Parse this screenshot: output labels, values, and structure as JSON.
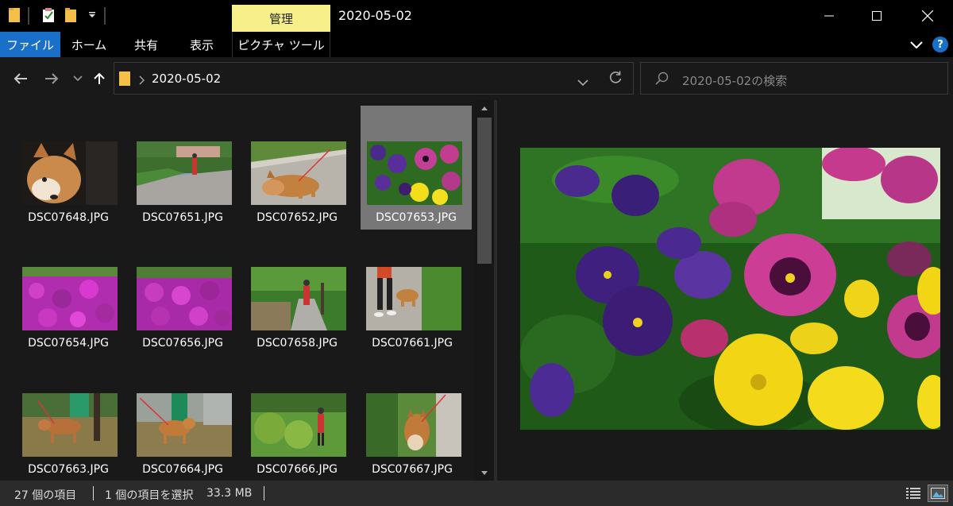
{
  "window": {
    "title": "2020-05-02",
    "manage_tab": "管理",
    "minimize_icon": "minimize-icon",
    "maximize_icon": "maximize-icon",
    "close_icon": "close-icon"
  },
  "quick_access": {
    "icons": [
      "folder-icon",
      "properties-icon",
      "new-folder-icon",
      "customize-dropdown-icon"
    ]
  },
  "ribbon": {
    "tabs": [
      "ファイル",
      "ホーム",
      "共有",
      "表示"
    ],
    "picture_tools": "ピクチャ ツール",
    "help_label": "?"
  },
  "nav": {
    "path": "2020-05-02",
    "search_placeholder": "2020-05-02の検索"
  },
  "files": [
    {
      "name": "DSC07648.JPG",
      "thumb": "shiba-dog-closeup"
    },
    {
      "name": "DSC07651.JPG",
      "thumb": "park-walkway"
    },
    {
      "name": "DSC07652.JPG",
      "thumb": "shiba-dog-walking"
    },
    {
      "name": "DSC07653.JPG",
      "thumb": "pansy-flowers",
      "selected": true
    },
    {
      "name": "DSC07654.JPG",
      "thumb": "azalea-bush"
    },
    {
      "name": "DSC07656.JPG",
      "thumb": "azalea-bush"
    },
    {
      "name": "DSC07658.JPG",
      "thumb": "tree-lined-path"
    },
    {
      "name": "DSC07661.JPG",
      "thumb": "person-walking-dog"
    },
    {
      "name": "DSC07663.JPG",
      "thumb": "dog-in-grass"
    },
    {
      "name": "DSC07664.JPG",
      "thumb": "dog-by-fence"
    },
    {
      "name": "DSC07666.JPG",
      "thumb": "green-park"
    },
    {
      "name": "DSC07667.JPG",
      "thumb": "dog-sniffing"
    }
  ],
  "status": {
    "count": "27 個の項目",
    "selected": "1 個の項目を選択",
    "size": "33.3 MB"
  },
  "colors": {
    "accent": "#1a6fc9",
    "manage_tab": "#f7f08a",
    "selection": "#777777",
    "background": "#191919"
  }
}
